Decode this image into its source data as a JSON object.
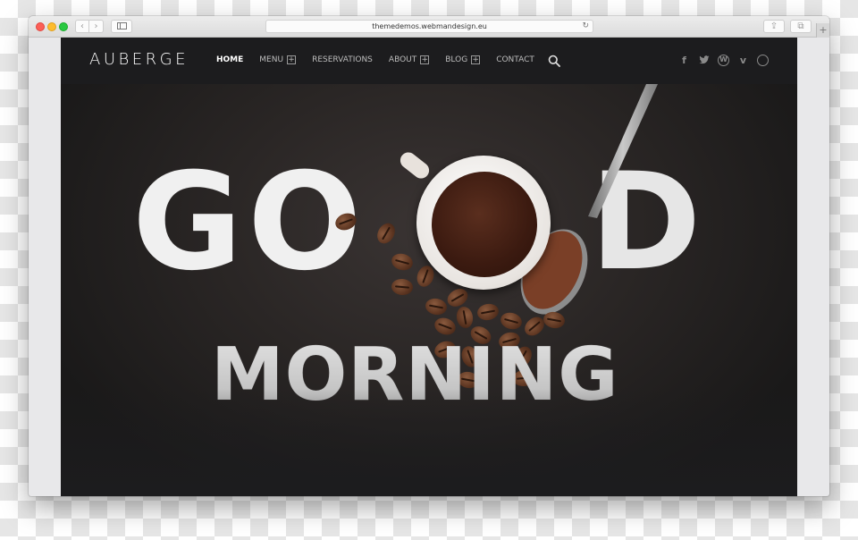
{
  "browser": {
    "url": "themedemos.webmandesign.eu",
    "buttons": {
      "back": "‹",
      "forward": "›",
      "reload": "↻",
      "share": "⇪",
      "tabs": "⧉",
      "new_tab": "+"
    }
  },
  "site": {
    "logo": "AUBERGE",
    "nav": [
      {
        "label": "HOME",
        "active": true,
        "has_submenu": false
      },
      {
        "label": "MENU",
        "active": false,
        "has_submenu": true
      },
      {
        "label": "RESERVATIONS",
        "active": false,
        "has_submenu": false
      },
      {
        "label": "ABOUT",
        "active": false,
        "has_submenu": true
      },
      {
        "label": "BLOG",
        "active": false,
        "has_submenu": true
      },
      {
        "label": "CONTACT",
        "active": false,
        "has_submenu": false
      }
    ],
    "submenu_glyph": "+",
    "socials": [
      {
        "name": "facebook",
        "glyph": "f"
      },
      {
        "name": "twitter",
        "glyph": "🐦"
      },
      {
        "name": "wordpress",
        "glyph": "W"
      },
      {
        "name": "vimeo",
        "glyph": "v"
      },
      {
        "name": "website",
        "glyph": "◍"
      }
    ]
  },
  "hero": {
    "line1_left": "GO",
    "line1_right": "D",
    "line2": "MORNING"
  }
}
